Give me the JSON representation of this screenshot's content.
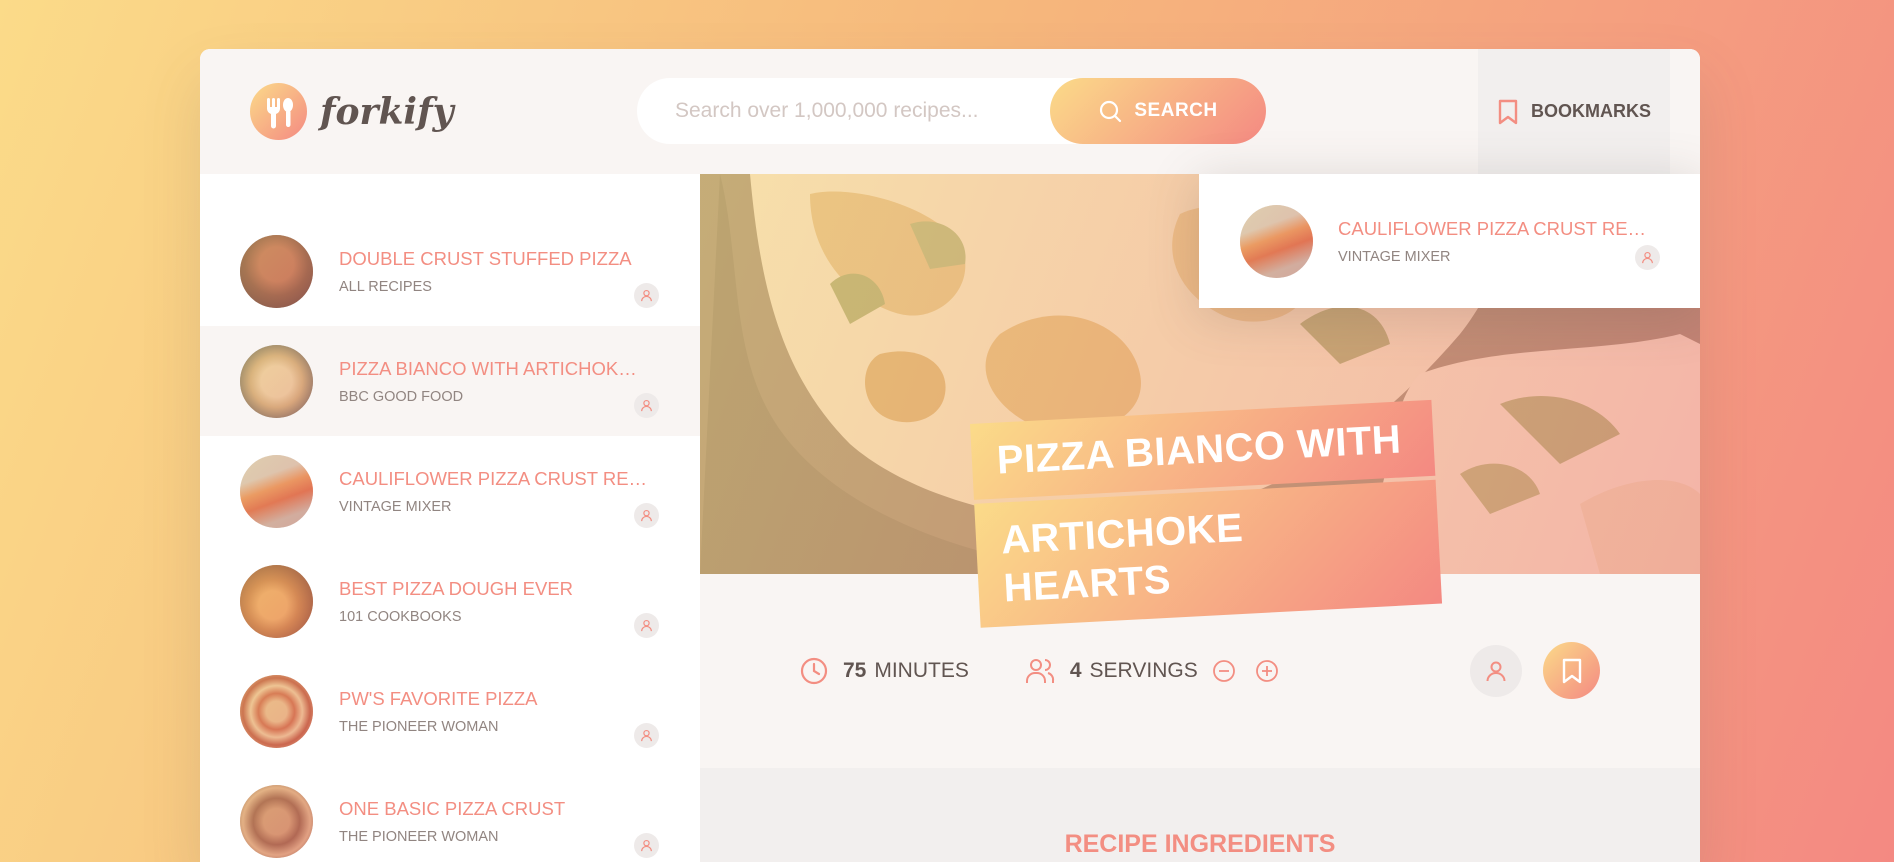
{
  "header": {
    "logo_text": "forkify",
    "search_placeholder": "Search over 1,000,000 recipes...",
    "search_button": "SEARCH",
    "bookmarks_label": "BOOKMARKS"
  },
  "results": [
    {
      "title": "DOUBLE CRUST STUFFED PIZZA",
      "publisher": "ALL RECIPES"
    },
    {
      "title": "PIZZA BIANCO WITH ARTICHOKE HEARTS",
      "publisher": "BBC GOOD FOOD"
    },
    {
      "title": "CAULIFLOWER PIZZA CRUST RECIPE",
      "publisher": "VINTAGE MIXER"
    },
    {
      "title": "BEST PIZZA DOUGH EVER",
      "publisher": "101 COOKBOOKS"
    },
    {
      "title": "PW'S FAVORITE PIZZA",
      "publisher": "THE PIONEER WOMAN"
    },
    {
      "title": "ONE BASIC PIZZA CRUST",
      "publisher": "THE PIONEER WOMAN"
    }
  ],
  "bookmark_preview": {
    "title": "CAULIFLOWER PIZZA CRUST RECIPE",
    "publisher": "VINTAGE MIXER"
  },
  "recipe": {
    "title_line_1": "PIZZA BIANCO WITH",
    "title_line_2": "ARTICHOKE HEARTS",
    "minutes_value": "75",
    "minutes_label": "MINUTES",
    "servings_value": "4",
    "servings_label": "SERVINGS",
    "ingredients_heading": "RECIPE INGREDIENTS"
  },
  "colors": {
    "accent_start": "#fbdb89",
    "accent_end": "#f48982",
    "text": "#615551",
    "title": "#f38e82"
  }
}
